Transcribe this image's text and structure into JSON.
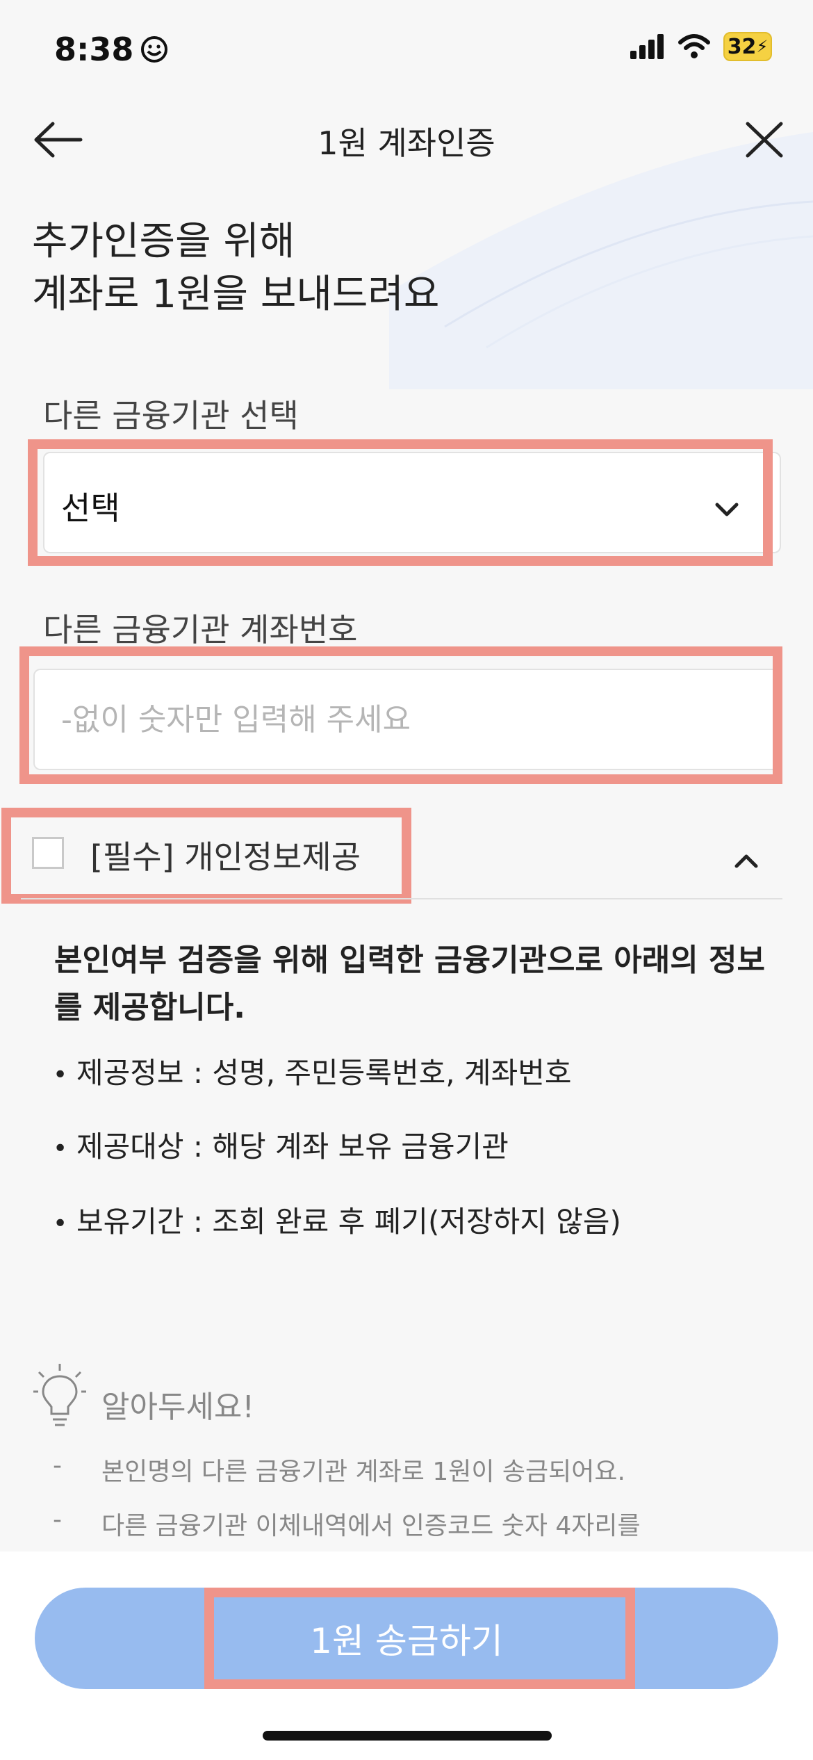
{
  "status_bar": {
    "time": "8:38",
    "battery": "32"
  },
  "header": {
    "title": "1원 계좌인증"
  },
  "headline": "추가인증을 위해\n계좌로 1원을 보내드려요",
  "bank_select": {
    "label": "다른 금융기관 선택",
    "value": "선택"
  },
  "account_number": {
    "label": "다른 금융기관 계좌번호",
    "placeholder": "-없이 숫자만 입력해 주세요",
    "value": ""
  },
  "consent": {
    "label": "[필수] 개인정보제공",
    "description": "본인여부 검증을 위해 입력한 금융기관으로 아래의 정보를 제공합니다.",
    "items": [
      "제공정보 : 성명, 주민등록번호, 계좌번호",
      "제공대상 : 해당 계좌 보유 금융기관",
      "보유기간 : 조회 완료 후 폐기(저장하지 않음)"
    ]
  },
  "tips": {
    "title": "알아두세요!",
    "items": [
      "본인명의 다른 금융기관 계좌로 1원이 송금되어요.",
      "다른 금융기관 이체내역에서 인증코드 숫자 4자리를"
    ]
  },
  "cta_label": "1원 송금하기",
  "colors": {
    "highlight": "#ef948a",
    "cta": "#97bbef",
    "background": "#f7f7f7"
  }
}
